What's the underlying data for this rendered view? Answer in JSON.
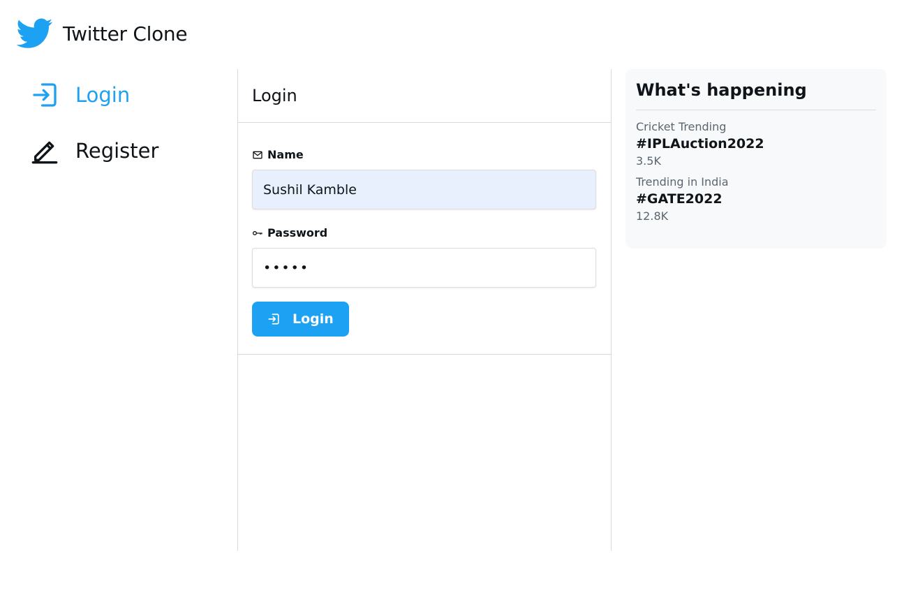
{
  "brand": {
    "title": "Twitter Clone",
    "icon": "twitter-bird-icon",
    "color": "#1da1f2"
  },
  "nav": {
    "items": [
      {
        "label": "Login",
        "icon": "login-icon",
        "active": true
      },
      {
        "label": "Register",
        "icon": "pencil-icon",
        "active": false
      }
    ]
  },
  "main": {
    "header": "Login",
    "form": {
      "name_label": "Name",
      "name_icon": "mail-icon",
      "name_value": "Sushil Kamble",
      "password_label": "Password",
      "password_icon": "key-icon",
      "password_value": "•••••",
      "submit_label": "Login",
      "submit_icon": "login-icon"
    }
  },
  "side": {
    "title": "What's happening",
    "trends": [
      {
        "category": "Cricket Trending",
        "tag": "#IPLAuction2022",
        "count": "3.5K"
      },
      {
        "category": "Trending in India",
        "tag": "#GATE2022",
        "count": "12.8K"
      }
    ]
  },
  "colors": {
    "accent": "#1da1f2",
    "filled_input": "#e8f0fe",
    "muted_text": "#5b6670"
  }
}
